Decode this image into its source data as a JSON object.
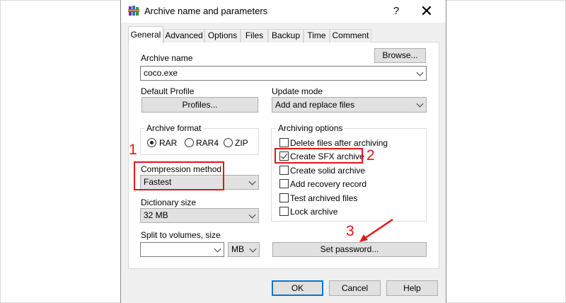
{
  "window": {
    "title": "Archive name and parameters",
    "help_glyph": "?",
    "close_glyph": "✕"
  },
  "tabs": [
    {
      "label": "General"
    },
    {
      "label": "Advanced"
    },
    {
      "label": "Options"
    },
    {
      "label": "Files"
    },
    {
      "label": "Backup"
    },
    {
      "label": "Time"
    },
    {
      "label": "Comment"
    }
  ],
  "general": {
    "archive_name_label": "Archive name",
    "browse_label": "Browse...",
    "archive_name_value": "coco.exe",
    "default_profile_label": "Default Profile",
    "profiles_label": "Profiles...",
    "update_mode_label": "Update mode",
    "update_mode_value": "Add and replace files",
    "archive_format_label": "Archive format",
    "formats": [
      "RAR",
      "RAR4",
      "ZIP"
    ],
    "selected_format": "RAR",
    "compression_method_label": "Compression method",
    "compression_method_value": "Fastest",
    "dictionary_size_label": "Dictionary size",
    "dictionary_size_value": "32 MB",
    "split_volumes_label": "Split to volumes, size",
    "split_volumes_value": "",
    "split_unit_value": "MB",
    "archiving_options_label": "Archiving options",
    "options": [
      {
        "label": "Delete files after archiving",
        "checked": false
      },
      {
        "label": "Create SFX archive",
        "checked": true
      },
      {
        "label": "Create solid archive",
        "checked": false
      },
      {
        "label": "Add recovery record",
        "checked": false
      },
      {
        "label": "Test archived files",
        "checked": false
      },
      {
        "label": "Lock archive",
        "checked": false
      }
    ],
    "set_password_label": "Set password..."
  },
  "buttons": {
    "ok": "OK",
    "cancel": "Cancel",
    "help": "Help"
  },
  "annotations": {
    "marker_1": "1",
    "marker_2": "2",
    "marker_3": "3",
    "color": "#e0161c"
  }
}
